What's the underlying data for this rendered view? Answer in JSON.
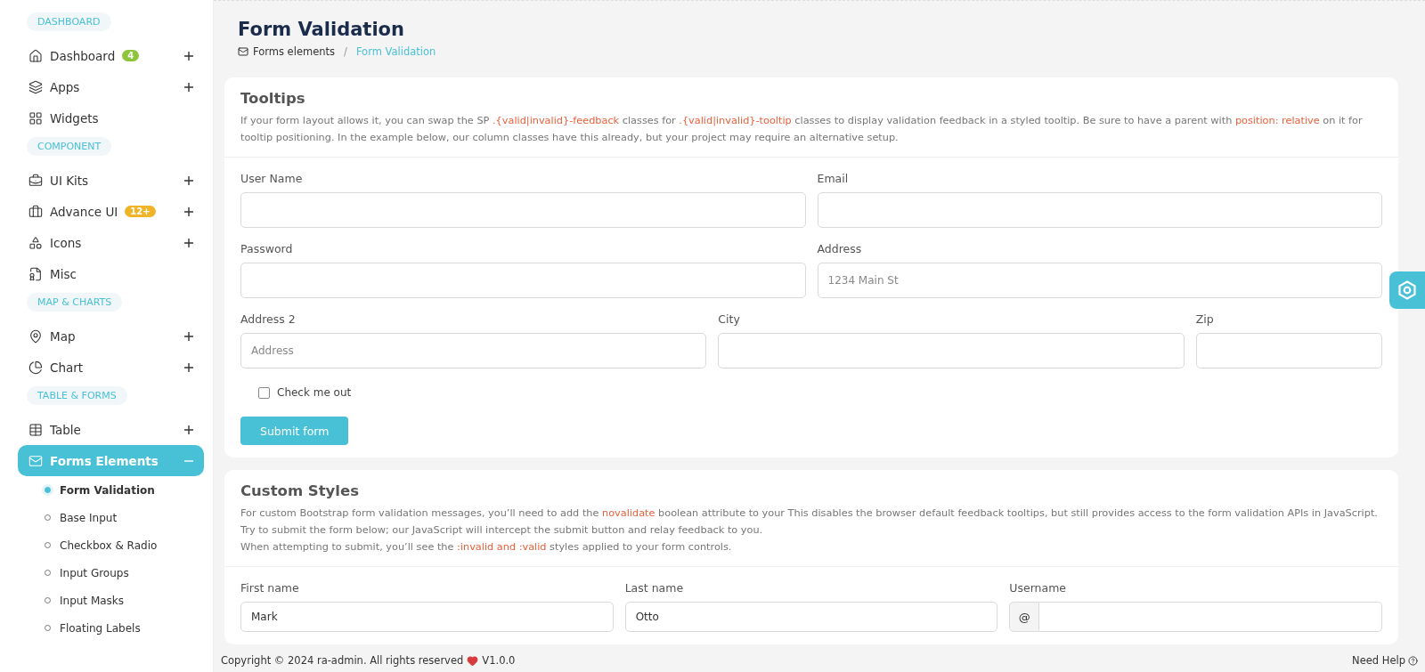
{
  "sidebar": {
    "sections": [
      {
        "title": "DASHBOARD",
        "items": [
          {
            "label": "Dashboard",
            "badge": {
              "text": "4",
              "color": "#8cc43c"
            },
            "expanded": false,
            "selected": false
          },
          {
            "label": "Apps",
            "expanded": false,
            "selected": false
          },
          {
            "label": "Widgets",
            "selected": false
          }
        ]
      },
      {
        "title": "COMPONENT",
        "items": [
          {
            "label": "UI Kits",
            "expanded": false,
            "selected": false
          },
          {
            "label": "Advance UI",
            "badge": {
              "text": "12+",
              "color": "#f0b429"
            },
            "expanded": false,
            "selected": false
          },
          {
            "label": "Icons",
            "expanded": false,
            "selected": false
          },
          {
            "label": "Misc",
            "selected": false
          }
        ]
      },
      {
        "title": "MAP & CHARTS",
        "items": [
          {
            "label": "Map",
            "expanded": false,
            "selected": false
          },
          {
            "label": "Chart",
            "expanded": false,
            "selected": false
          }
        ]
      },
      {
        "title": "TABLE & FORMS",
        "items": [
          {
            "label": "Table",
            "expanded": false,
            "selected": false
          },
          {
            "label": "Forms Elements",
            "expanded": true,
            "selected": true,
            "children": [
              {
                "label": "Form Validation",
                "selected": true
              },
              {
                "label": "Base Input",
                "selected": false
              },
              {
                "label": "Checkbox & Radio",
                "selected": false
              },
              {
                "label": "Input Groups",
                "selected": false
              },
              {
                "label": "Input Masks",
                "selected": false
              },
              {
                "label": "Floating Labels",
                "selected": false
              }
            ]
          }
        ]
      }
    ]
  },
  "page": {
    "title": "Form Validation",
    "breadcrumb_separator": "/",
    "breadcrumb": [
      {
        "label": "Forms elements",
        "selected": false
      },
      {
        "label": "Form Validation",
        "selected": true
      }
    ]
  },
  "cards": [
    {
      "title": "Tooltips",
      "description": [
        [
          {
            "kind": "text",
            "text": "If your form layout allows it, you can swap the SP "
          },
          {
            "kind": "code",
            "text": ".{valid|invalid}-feedback"
          },
          {
            "kind": "text",
            "text": " classes for "
          },
          {
            "kind": "code",
            "text": ".{valid|invalid}-tooltip"
          },
          {
            "kind": "text",
            "text": " classes to display validation feedback in a styled tooltip. Be sure to have a parent with "
          },
          {
            "kind": "code",
            "text": "position: relative"
          },
          {
            "kind": "text",
            "text": " on it for tooltip positioning. In the example below, our column classes have this already, but your project may require an alternative setup."
          }
        ]
      ],
      "rows": [
        [
          {
            "label": "User Name"
          },
          {
            "label": "Email"
          }
        ],
        [
          {
            "label": "Password"
          },
          {
            "label": "Address",
            "placeholder": "1234 Main St"
          }
        ],
        [
          {
            "label": "Address 2",
            "placeholder": "Address"
          },
          {
            "label": "City"
          },
          {
            "label": "Zip"
          }
        ]
      ],
      "checkbox": {
        "label": "Check me out",
        "checked": false
      },
      "button": "Submit form"
    },
    {
      "title": "Custom Styles",
      "description": [
        [
          {
            "kind": "text",
            "text": "For custom Bootstrap form validation messages, you’ll need to add the "
          },
          {
            "kind": "code",
            "text": "novalidate"
          },
          {
            "kind": "text",
            "text": " boolean attribute to your This disables the browser default feedback tooltips, but still provides access to the form validation APIs in JavaScript. Try to submit the form below; our JavaScript will intercept the submit button and relay feedback to you."
          }
        ],
        [
          {
            "kind": "text",
            "text": "When attempting to submit, you’ll see the "
          },
          {
            "kind": "code",
            "text": ":invalid and :valid"
          },
          {
            "kind": "text",
            "text": " styles applied to your form controls."
          }
        ]
      ],
      "rows": [
        [
          {
            "label": "First name",
            "value": "Mark"
          },
          {
            "label": "Last name",
            "value": "Otto"
          },
          {
            "label": "Username",
            "prefix": "@"
          }
        ]
      ]
    }
  ],
  "footer": {
    "copyright": "Copyright © 2024 ra-admin. All rights reserved",
    "version": "V1.0.0",
    "help": "Need Help"
  }
}
